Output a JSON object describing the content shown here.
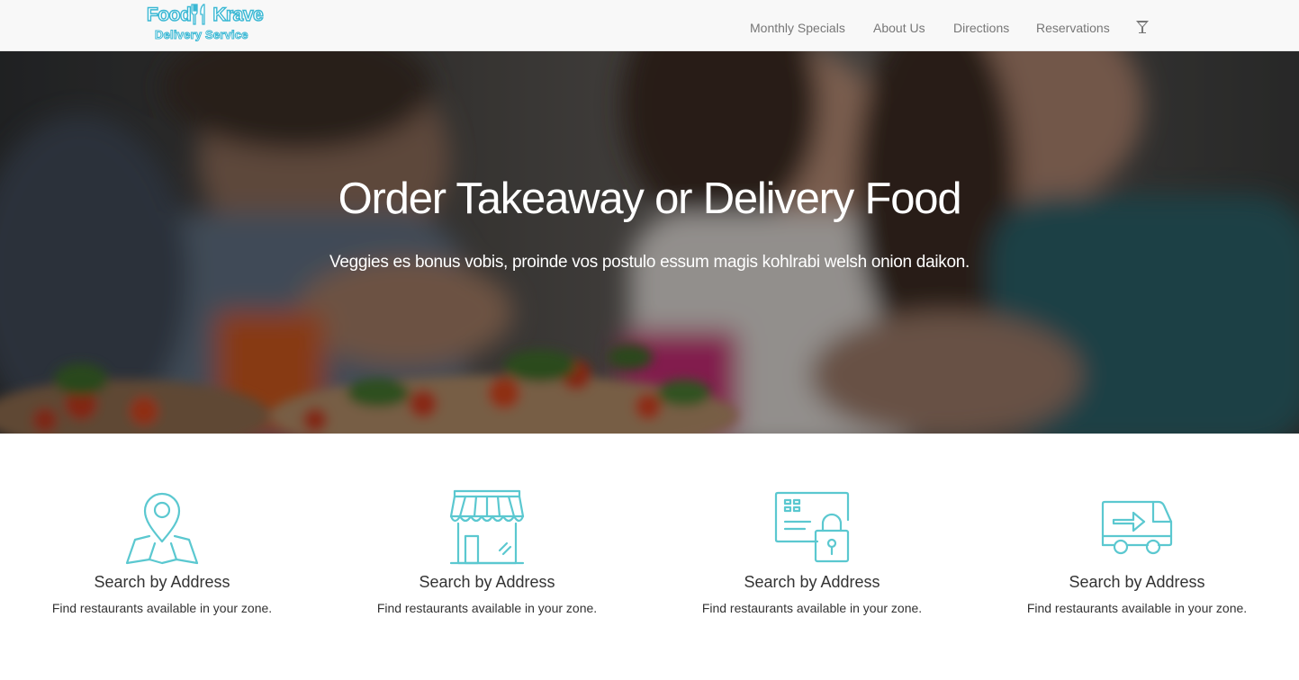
{
  "brand": {
    "logo_line1_left": "Food",
    "logo_line1_right": "Krave",
    "logo_line2": "Delivery Service",
    "logo_color": "#3bb8d4"
  },
  "nav": {
    "items": [
      {
        "label": "Monthly Specials"
      },
      {
        "label": "About Us"
      },
      {
        "label": "Directions"
      },
      {
        "label": "Reservations"
      }
    ],
    "cocktail_icon": "cocktail-glass-icon"
  },
  "hero": {
    "title": "Order Takeaway or Delivery Food",
    "subtitle": "Veggies es bonus vobis, proinde vos postulo essum magis kohlrabi welsh onion daikon."
  },
  "features": {
    "accent_color": "#5bc8d0",
    "items": [
      {
        "icon": "map-pin-icon",
        "title": "Search by Address",
        "text": "Find restaurants available in your zone."
      },
      {
        "icon": "storefront-icon",
        "title": "Search by Address",
        "text": "Find restaurants available in your zone."
      },
      {
        "icon": "secure-payment-icon",
        "title": "Search by Address",
        "text": "Find restaurants available in your zone."
      },
      {
        "icon": "delivery-truck-icon",
        "title": "Search by Address",
        "text": "Find restaurants available in your zone."
      }
    ]
  }
}
